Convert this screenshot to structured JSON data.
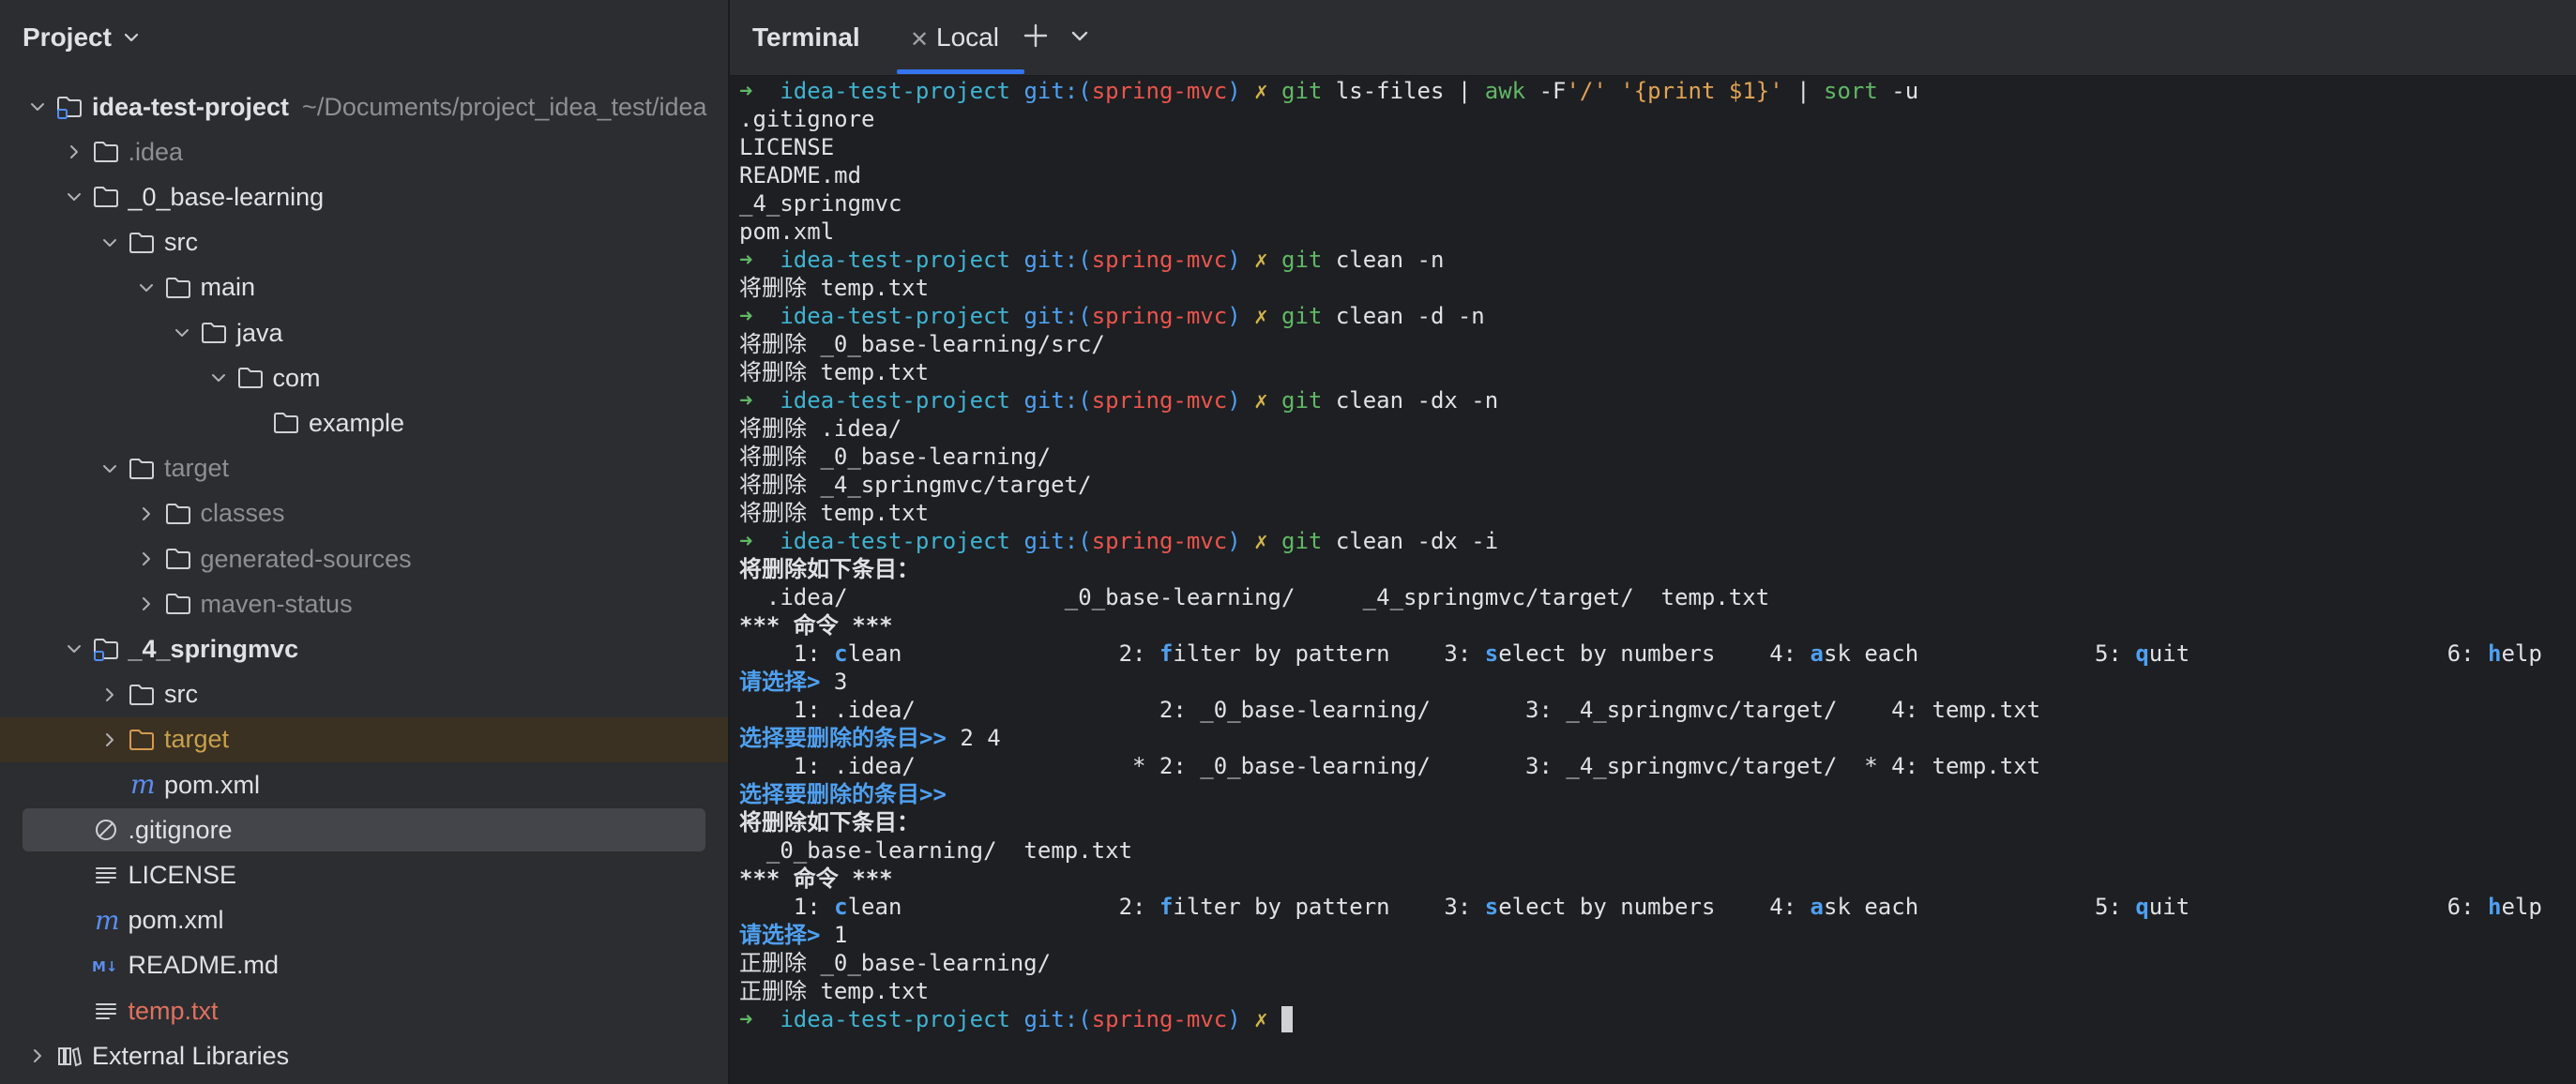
{
  "project_panel": {
    "title": "Project",
    "tree": [
      {
        "label": "idea-test-project",
        "hint": "~/Documents/project_idea_test/idea",
        "indent": 0,
        "arrow": "down",
        "icon": "module-folder-icon",
        "style": "bold"
      },
      {
        "label": ".idea",
        "indent": 1,
        "arrow": "right",
        "icon": "folder-icon",
        "style": "dim"
      },
      {
        "label": "_0_base-learning",
        "indent": 1,
        "arrow": "down",
        "icon": "folder-icon",
        "style": "normal"
      },
      {
        "label": "src",
        "indent": 2,
        "arrow": "down",
        "icon": "folder-icon",
        "style": "normal"
      },
      {
        "label": "main",
        "indent": 3,
        "arrow": "down",
        "icon": "folder-icon",
        "style": "normal"
      },
      {
        "label": "java",
        "indent": 4,
        "arrow": "down",
        "icon": "folder-icon",
        "style": "normal"
      },
      {
        "label": "com",
        "indent": 5,
        "arrow": "down",
        "icon": "folder-icon",
        "style": "normal"
      },
      {
        "label": "example",
        "indent": 6,
        "arrow": "none",
        "icon": "folder-icon",
        "style": "normal"
      },
      {
        "label": "target",
        "indent": 2,
        "arrow": "down",
        "icon": "folder-icon",
        "style": "dim"
      },
      {
        "label": "classes",
        "indent": 3,
        "arrow": "right",
        "icon": "folder-icon",
        "style": "dim"
      },
      {
        "label": "generated-sources",
        "indent": 3,
        "arrow": "right",
        "icon": "folder-icon",
        "style": "dim"
      },
      {
        "label": "maven-status",
        "indent": 3,
        "arrow": "right",
        "icon": "folder-icon",
        "style": "dim"
      },
      {
        "label": "_4_springmvc",
        "indent": 1,
        "arrow": "down",
        "icon": "module-folder-icon",
        "style": "bold"
      },
      {
        "label": "src",
        "indent": 2,
        "arrow": "right",
        "icon": "folder-icon",
        "style": "normal"
      },
      {
        "label": "target",
        "indent": 2,
        "arrow": "right",
        "icon": "folder-orange-icon",
        "style": "yellow",
        "row": "highlight"
      },
      {
        "label": "pom.xml",
        "indent": 2,
        "arrow": "none",
        "icon": "maven-icon",
        "style": "normal"
      },
      {
        "label": ".gitignore",
        "indent": 1,
        "arrow": "none",
        "icon": "ignore-icon",
        "style": "normal",
        "row": "selected"
      },
      {
        "label": "LICENSE",
        "indent": 1,
        "arrow": "none",
        "icon": "text-file-icon",
        "style": "normal"
      },
      {
        "label": "pom.xml",
        "indent": 1,
        "arrow": "none",
        "icon": "maven-icon",
        "style": "normal"
      },
      {
        "label": "README.md",
        "indent": 1,
        "arrow": "none",
        "icon": "markdown-icon",
        "style": "normal"
      },
      {
        "label": "temp.txt",
        "indent": 1,
        "arrow": "none",
        "icon": "text-file-icon",
        "style": "red"
      },
      {
        "label": "External Libraries",
        "indent": 0,
        "arrow": "right",
        "icon": "libraries-icon",
        "style": "normal"
      }
    ]
  },
  "terminal": {
    "title": "Terminal",
    "tab_label": "Local",
    "new_tab_icon": "plus-icon",
    "menu_icon": "chevron-down-icon",
    "lines": [
      [
        {
          "t": "➜  ",
          "c": "green"
        },
        {
          "t": "idea-test-project ",
          "c": "cyan"
        },
        {
          "t": "git:(",
          "c": "blue"
        },
        {
          "t": "spring-mvc",
          "c": "red"
        },
        {
          "t": ") ",
          "c": "blue"
        },
        {
          "t": "✗ ",
          "c": "yellow"
        },
        {
          "t": "git ",
          "c": "green"
        },
        {
          "t": "ls-files | "
        },
        {
          "t": "awk ",
          "c": "green"
        },
        {
          "t": "-F"
        },
        {
          "t": "'/'",
          "c": "orange"
        },
        {
          "t": " "
        },
        {
          "t": "'{print $1}'",
          "c": "orange"
        },
        {
          "t": " | "
        },
        {
          "t": "sort ",
          "c": "green"
        },
        {
          "t": "-u"
        }
      ],
      [
        {
          "t": ".gitignore"
        }
      ],
      [
        {
          "t": "LICENSE"
        }
      ],
      [
        {
          "t": "README.md"
        }
      ],
      [
        {
          "t": "_4_springmvc"
        }
      ],
      [
        {
          "t": "pom.xml"
        }
      ],
      [
        {
          "t": "➜  ",
          "c": "green"
        },
        {
          "t": "idea-test-project ",
          "c": "cyan"
        },
        {
          "t": "git:(",
          "c": "blue"
        },
        {
          "t": "spring-mvc",
          "c": "red"
        },
        {
          "t": ") ",
          "c": "blue"
        },
        {
          "t": "✗ ",
          "c": "yellow"
        },
        {
          "t": "git ",
          "c": "green"
        },
        {
          "t": "clean -n"
        }
      ],
      [
        {
          "t": "将删除 temp.txt"
        }
      ],
      [
        {
          "t": "➜  ",
          "c": "green"
        },
        {
          "t": "idea-test-project ",
          "c": "cyan"
        },
        {
          "t": "git:(",
          "c": "blue"
        },
        {
          "t": "spring-mvc",
          "c": "red"
        },
        {
          "t": ") ",
          "c": "blue"
        },
        {
          "t": "✗ ",
          "c": "yellow"
        },
        {
          "t": "git ",
          "c": "green"
        },
        {
          "t": "clean -d -n"
        }
      ],
      [
        {
          "t": "将删除 _0_base-learning/src/"
        }
      ],
      [
        {
          "t": "将删除 temp.txt"
        }
      ],
      [
        {
          "t": "➜  ",
          "c": "green"
        },
        {
          "t": "idea-test-project ",
          "c": "cyan"
        },
        {
          "t": "git:(",
          "c": "blue"
        },
        {
          "t": "spring-mvc",
          "c": "red"
        },
        {
          "t": ") ",
          "c": "blue"
        },
        {
          "t": "✗ ",
          "c": "yellow"
        },
        {
          "t": "git ",
          "c": "green"
        },
        {
          "t": "clean -dx -n"
        }
      ],
      [
        {
          "t": "将删除 .idea/"
        }
      ],
      [
        {
          "t": "将删除 _0_base-learning/"
        }
      ],
      [
        {
          "t": "将删除 _4_springmvc/target/"
        }
      ],
      [
        {
          "t": "将删除 temp.txt"
        }
      ],
      [
        {
          "t": "➜  ",
          "c": "green"
        },
        {
          "t": "idea-test-project ",
          "c": "cyan"
        },
        {
          "t": "git:(",
          "c": "blue"
        },
        {
          "t": "spring-mvc",
          "c": "red"
        },
        {
          "t": ") ",
          "c": "blue"
        },
        {
          "t": "✗ ",
          "c": "yellow"
        },
        {
          "t": "git ",
          "c": "green"
        },
        {
          "t": "clean -dx -i"
        }
      ],
      [
        {
          "t": "将删除如下条目：",
          "c": "bold"
        }
      ],
      [
        {
          "t": "  .idea/                _0_base-learning/     _4_springmvc/target/  temp.txt"
        }
      ],
      [
        {
          "t": "*** 命令 ***",
          "c": "bold"
        }
      ],
      [
        {
          "t": "    1: "
        },
        {
          "t": "c",
          "c": "bblue"
        },
        {
          "t": "lean                2: "
        },
        {
          "t": "f",
          "c": "bblue"
        },
        {
          "t": "ilter by pattern    3: "
        },
        {
          "t": "s",
          "c": "bblue"
        },
        {
          "t": "elect by numbers    4: "
        },
        {
          "t": "a",
          "c": "bblue"
        },
        {
          "t": "sk each             5: "
        },
        {
          "t": "q",
          "c": "bblue"
        },
        {
          "t": "uit                   6: "
        },
        {
          "t": "h",
          "c": "bblue"
        },
        {
          "t": "elp"
        }
      ],
      [
        {
          "t": "请选择> ",
          "c": "bblue"
        },
        {
          "t": "3"
        }
      ],
      [
        {
          "t": "    1: .idea/                  2: _0_base-learning/       3: _4_springmvc/target/    4: temp.txt"
        }
      ],
      [
        {
          "t": "选择要删除的条目>> ",
          "c": "bblue"
        },
        {
          "t": "2 4"
        }
      ],
      [
        {
          "t": "    1: .idea/                * 2: _0_base-learning/       3: _4_springmvc/target/  * 4: temp.txt"
        }
      ],
      [
        {
          "t": "选择要删除的条目>>",
          "c": "bblue"
        }
      ],
      [
        {
          "t": "将删除如下条目：",
          "c": "bold"
        }
      ],
      [
        {
          "t": "  _0_base-learning/  temp.txt"
        }
      ],
      [
        {
          "t": "*** 命令 ***",
          "c": "bold"
        }
      ],
      [
        {
          "t": "    1: "
        },
        {
          "t": "c",
          "c": "bblue"
        },
        {
          "t": "lean                2: "
        },
        {
          "t": "f",
          "c": "bblue"
        },
        {
          "t": "ilter by pattern    3: "
        },
        {
          "t": "s",
          "c": "bblue"
        },
        {
          "t": "elect by numbers    4: "
        },
        {
          "t": "a",
          "c": "bblue"
        },
        {
          "t": "sk each             5: "
        },
        {
          "t": "q",
          "c": "bblue"
        },
        {
          "t": "uit                   6: "
        },
        {
          "t": "h",
          "c": "bblue"
        },
        {
          "t": "elp"
        }
      ],
      [
        {
          "t": "请选择> ",
          "c": "bblue"
        },
        {
          "t": "1"
        }
      ],
      [
        {
          "t": "正删除 _0_base-learning/"
        }
      ],
      [
        {
          "t": "正删除 temp.txt"
        }
      ],
      [
        {
          "t": "➜  ",
          "c": "green"
        },
        {
          "t": "idea-test-project ",
          "c": "cyan"
        },
        {
          "t": "git:(",
          "c": "blue"
        },
        {
          "t": "spring-mvc",
          "c": "red"
        },
        {
          "t": ") ",
          "c": "blue"
        },
        {
          "t": "✗ ",
          "c": "yellow"
        },
        {
          "t": "",
          "cursor": true
        }
      ]
    ]
  },
  "colors": {
    "panel_bg": "#2b2d30",
    "terminal_bg": "#1e1f22",
    "accent": "#3574f0",
    "prompt_green": "#5fb865",
    "prompt_cyan": "#3fb3d2",
    "branch_red": "#e8554e",
    "dim_text": "#8c8f94"
  }
}
